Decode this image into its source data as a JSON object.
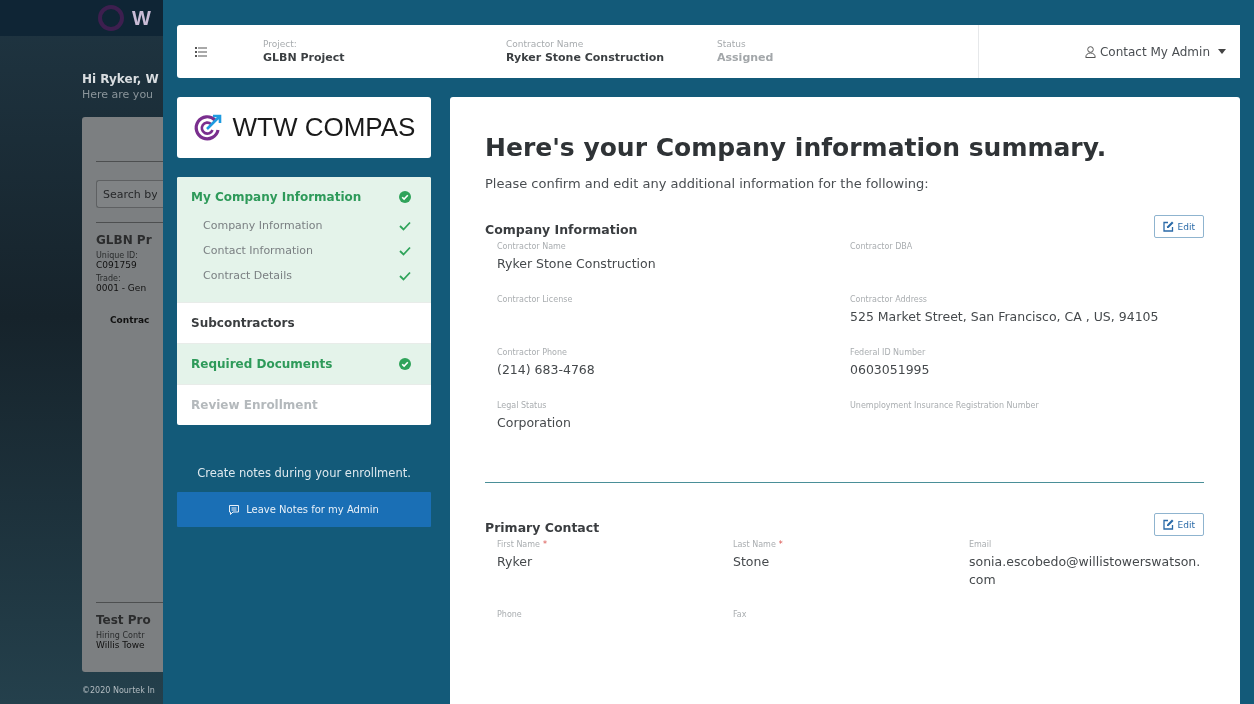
{
  "background": {
    "logo_text": "W",
    "greeting": "Hi Ryker, W",
    "subgreeting": "Here are you",
    "search": {
      "placeholder": "Search by"
    },
    "projects": [
      {
        "title": "GLBN Pr",
        "fields": [
          {
            "label": "Unique ID:",
            "value": "C091759"
          },
          {
            "label": "Trade:",
            "value": "0001 - Gen"
          }
        ],
        "button": "Contrac"
      },
      {
        "title": "Test Pro",
        "fields": [
          {
            "label": "Hiring Contr",
            "value": "Willis Towe"
          }
        ]
      }
    ],
    "footer": "©2020 Nourtek In"
  },
  "header": {
    "fields": [
      {
        "label": "Project:",
        "value": "GLBN Project",
        "muted": false
      },
      {
        "label": "Contractor Name",
        "value": "Ryker Stone Construction",
        "muted": false
      },
      {
        "label": "Status",
        "value": "Assigned",
        "muted": true
      }
    ],
    "contact_menu": "Contact My Admin"
  },
  "logo": {
    "text": "WTW COMPAS"
  },
  "nav": {
    "items": [
      {
        "label": "My Company Information",
        "completed": true,
        "disabled": false,
        "children": [
          {
            "label": "Company Information",
            "completed": true
          },
          {
            "label": "Contact Information",
            "completed": true
          },
          {
            "label": "Contract Details",
            "completed": true
          }
        ]
      },
      {
        "label": "Subcontractors",
        "completed": false,
        "disabled": false
      },
      {
        "label": "Required Documents",
        "completed": true,
        "disabled": false
      },
      {
        "label": "Review Enrollment",
        "completed": false,
        "disabled": true
      }
    ]
  },
  "notes": {
    "text": "Create notes during your enrollment.",
    "button": "Leave Notes for my Admin"
  },
  "summary": {
    "title": "Here's your Company information summary.",
    "subtitle": "Please confirm and edit any additional information for the following:",
    "sections": [
      {
        "title": "Company Information",
        "edit_button": "Edit",
        "rows": [
          [
            {
              "label": "Contractor Name",
              "value": "Ryker Stone Construction"
            },
            {
              "label": "Contractor DBA"
            }
          ],
          [
            {
              "label": "Contractor License"
            },
            {
              "label": "Contractor Address",
              "value": "525 Market Street, San Francisco, CA , US, 94105"
            }
          ],
          [
            {
              "label": "Contractor Phone",
              "value": "(214) 683-4768"
            },
            {
              "label": "Federal ID Number",
              "value": "0603051995"
            }
          ],
          [
            {
              "label": "Legal Status",
              "value": "Corporation"
            },
            {
              "label": "Unemployment Insurance Registration Number"
            }
          ]
        ]
      },
      {
        "title": "Primary Contact",
        "edit_button": "Edit",
        "rows": [
          [
            {
              "label": "First Name",
              "required_mark": "*",
              "value": "Ryker"
            },
            {
              "label": "Last Name",
              "required_mark": "*",
              "value": "Stone"
            },
            {
              "label": "Email",
              "value": "sonia.escobedo@willistowerswatson.com"
            }
          ],
          [
            {
              "label": "Phone"
            },
            {
              "label": "Fax"
            }
          ]
        ]
      }
    ]
  }
}
